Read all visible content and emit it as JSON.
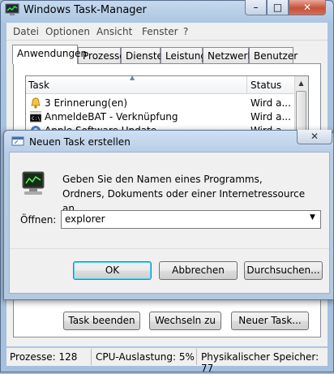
{
  "window": {
    "title": "Windows Task-Manager",
    "minimize_glyph": "–",
    "maximize_glyph": "□",
    "close_glyph": "✕"
  },
  "menu": [
    "Datei",
    "Optionen",
    "Ansicht",
    "Fenster",
    "?"
  ],
  "tabs": [
    "Anwendungen",
    "Prozesse",
    "Dienste",
    "Leistung",
    "Netzwerk",
    "Benutzer"
  ],
  "table": {
    "headers": {
      "task": "Task",
      "status": "Status"
    },
    "rows": [
      {
        "name": "3 Erinnerung(en)",
        "status": "Wird a...",
        "icon": "bell-icon"
      },
      {
        "name": "AnmeldeBAT - Verknüpfung",
        "status": "Wird a...",
        "icon": "console-icon"
      },
      {
        "name": "Apple Software Update",
        "status": "Wird a...",
        "icon": "apple-update-icon"
      }
    ]
  },
  "buttons": {
    "end_task": "Task beenden",
    "switch_to": "Wechseln zu",
    "new_task": "Neuer Task..."
  },
  "statusbar": {
    "processes": "Prozesse: 128",
    "cpu": "CPU-Auslastung: 5%",
    "memory": "Physikalischer Speicher: 77"
  },
  "dialog": {
    "title": "Neuen Task erstellen",
    "description": "Geben Sie den Namen eines Programms, Ordners, Dokuments oder einer Internetressource an.",
    "open_label": "Öffnen:",
    "open_value": "explorer",
    "ok": "OK",
    "cancel": "Abbrechen",
    "browse": "Durchsuchen..."
  },
  "colors": {
    "window_frame": "#a9c3e0",
    "close_red": "#c7503a",
    "focus_blue": "#3c7fb1"
  }
}
